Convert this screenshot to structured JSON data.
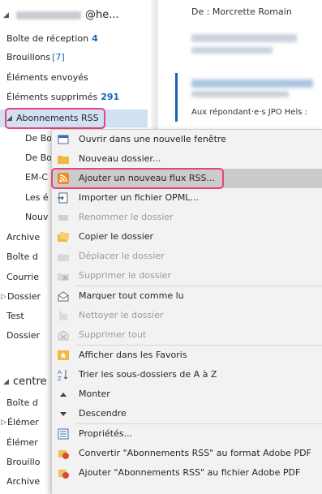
{
  "account": {
    "email_suffix": "@he..."
  },
  "folders": {
    "inbox": {
      "label": "Boîte de réception",
      "count": "4"
    },
    "drafts": {
      "label": "Brouillons",
      "count": "[7]"
    },
    "sent": {
      "label": "Éléments envoyés"
    },
    "deleted": {
      "label": "Éléments supprimés",
      "count": "291"
    },
    "rss": {
      "label": "Abonnements RSS"
    },
    "rss_children": [
      "De Bo",
      "De Bo",
      "EM-C",
      "Les é",
      "Nouv"
    ],
    "others": [
      "Archive",
      "Boîte d",
      "Courrie",
      "Dossier",
      "Test",
      "Dossier"
    ],
    "account2": {
      "label": "centre"
    },
    "account2_children": [
      "Boîte d",
      "Élémer",
      "Élémer",
      "Brouillo",
      "Archive"
    ]
  },
  "reading_pane": {
    "from": "De : Morcrette Romain",
    "snippet": "Aux répondant·e·s JPO Hels :"
  },
  "context_menu": {
    "items": [
      {
        "label": "Ouvrir dans une nouvelle fenêtre",
        "icon": "new-window-icon",
        "enabled": true
      },
      {
        "label": "Nouveau dossier...",
        "icon": "new-folder-icon",
        "enabled": true
      },
      {
        "label": "Ajouter un nouveau flux RSS...",
        "icon": "rss-icon",
        "enabled": true
      },
      {
        "label": "Importer un fichier OPML...",
        "icon": "import-icon",
        "enabled": true
      },
      {
        "label": "Renommer le dossier",
        "icon": "rename-icon",
        "enabled": false
      },
      {
        "label": "Copier le dossier",
        "icon": "copy-folder-icon",
        "enabled": true
      },
      {
        "label": "Déplacer le dossier",
        "icon": "move-folder-icon",
        "enabled": false
      },
      {
        "label": "Supprimer le dossier",
        "icon": "delete-folder-icon",
        "enabled": false
      },
      {
        "label": "Marquer tout comme lu",
        "icon": "mark-read-icon",
        "enabled": true
      },
      {
        "label": "Nettoyer le dossier",
        "icon": "clean-icon",
        "enabled": false
      },
      {
        "label": "Supprimer tout",
        "icon": "delete-all-icon",
        "enabled": false
      },
      {
        "label": "Afficher dans les Favoris",
        "icon": "star-icon",
        "enabled": true
      },
      {
        "label": "Trier les sous-dossiers de A à Z",
        "icon": "sort-az-icon",
        "enabled": true
      },
      {
        "label": "Monter",
        "icon": "move-up-icon",
        "enabled": true
      },
      {
        "label": "Descendre",
        "icon": "move-down-icon",
        "enabled": true
      },
      {
        "label": "Propriétés...",
        "icon": "properties-icon",
        "enabled": true
      },
      {
        "label": "Convertir \"Abonnements RSS\" au format Adobe PDF",
        "icon": "pdf-convert-icon",
        "enabled": true
      },
      {
        "label": "Ajouter \"Abonnements RSS\" au fichier Adobe PDF",
        "icon": "pdf-append-icon",
        "enabled": true
      }
    ]
  },
  "colors": {
    "accent": "#1a63b6",
    "highlight": "#e8437c",
    "selected": "#cfe1f3",
    "menu_hover": "#cbcbcb"
  }
}
